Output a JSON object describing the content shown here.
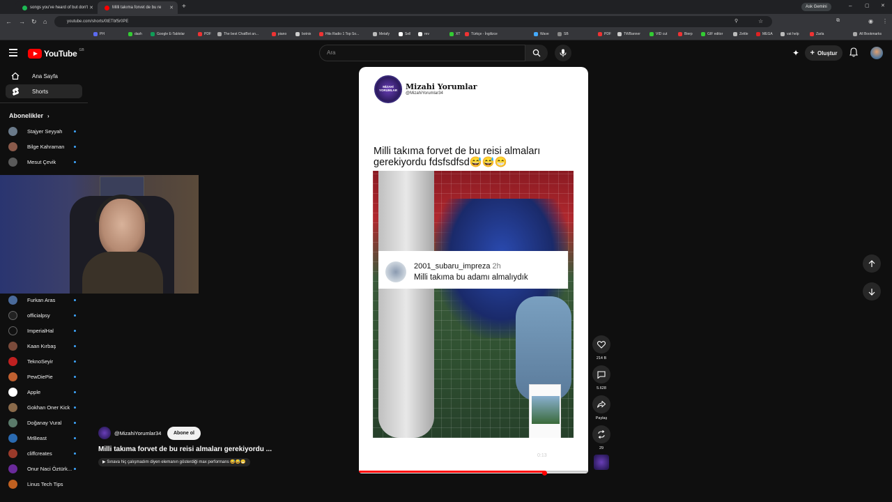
{
  "browser": {
    "tabs": [
      {
        "title": "songs you've heard of but don't",
        "favicon_color": "#1db954",
        "active": false
      },
      {
        "title": "Milli takıma forvet de bu re",
        "favicon_color": "#ff0000",
        "active": true
      }
    ],
    "new_tab": "+",
    "url": "youtube.com/shorts/0tETbf5r0PE",
    "ask_gemini": "Ask Gemini",
    "bookmarks": [
      "PH",
      "dash",
      "Google E-Tablolar",
      "PDF",
      "The best ChatBot an...",
      "piano",
      "botnix",
      "Hits Radio 1 Top So...",
      "Metafy",
      "Sell",
      "rev",
      "XT",
      "Türkçe - İngilizce",
      "Wave",
      "SB",
      "PDF",
      "TWBanner",
      "VID cut",
      "Bierp",
      "GIF editor",
      "Zettle",
      "MEGA",
      "vat help",
      "Zarla"
    ],
    "all_bookmarks": "All Bookmarks"
  },
  "masthead": {
    "logo": "YouTube",
    "country": "GB",
    "search_placeholder": "Ara",
    "create_label": "Oluştur"
  },
  "sidebar": {
    "items": [
      {
        "label": "Ana Sayfa",
        "icon": "home-icon"
      },
      {
        "label": "Shorts",
        "icon": "shorts-icon",
        "active": true
      }
    ],
    "subscriptions_title": "Abonelikler",
    "subscriptions_top": [
      {
        "name": "Stajyer Seyyah",
        "color": "#6a7a8a"
      },
      {
        "name": "Bilge Kahraman",
        "color": "#8a5a4a"
      },
      {
        "name": "Mesut Çevik",
        "color": "#5a5a5a"
      }
    ],
    "subscriptions_bottom": [
      {
        "name": "Furkan Aras",
        "color": "#4a6a9a"
      },
      {
        "name": "officialpsy",
        "color": "#222222"
      },
      {
        "name": "ImperialHal",
        "color": "#111111"
      },
      {
        "name": "Kaan Kırbaş",
        "color": "#7a4a3a"
      },
      {
        "name": "TeknoSeyir",
        "color": "#c02020"
      },
      {
        "name": "PewDiePie",
        "color": "#c06030"
      },
      {
        "name": "Apple",
        "color": "#ffffff"
      },
      {
        "name": "Gokhan Oner Kick",
        "color": "#8a6a4a"
      },
      {
        "name": "Doğanay Vural",
        "color": "#5a7a6a"
      },
      {
        "name": "MrBeast",
        "color": "#2a6ab0"
      },
      {
        "name": "cliffcreates",
        "color": "#9a3a2a"
      },
      {
        "name": "Onur Naci Öztürk...",
        "color": "#6a2a9a"
      },
      {
        "name": "Linus Tech Tips",
        "color": "#c06020"
      }
    ]
  },
  "short": {
    "channel_name": "Mizahi Yorumlar",
    "channel_handle": "@MizahiYorumlar34",
    "logo_text": "MİZAHİ YORUMLAR",
    "caption": "Milli takıma forvet de bu reisi almaları gerekiyordu fdsfsdfsd😅😅😁",
    "comment_user": "2001_subaru_impreza",
    "comment_time": "2h",
    "comment_text": "Milli takıma bu adamı almalıydık",
    "timestamp": "0:13",
    "progress": 0.81
  },
  "actions": {
    "likes": "214 B",
    "comments": "5.628",
    "share": "Paylaş",
    "remix": "29"
  },
  "overlay": {
    "handle": "@MizahiYorumlar34",
    "subscribe": "Abone ol",
    "title": "Milli takıma forvet de bu reisi almaları gerekiyordu ...",
    "related": "Sınava hiç çalışmadım diyen elemanın gösterdiği max performans 😅😅😁"
  }
}
